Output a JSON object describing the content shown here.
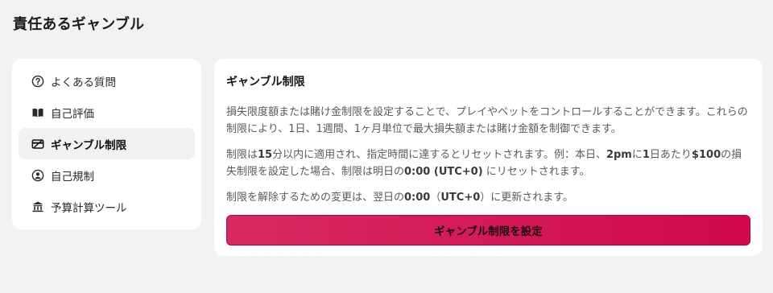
{
  "page": {
    "title": "責任あるギャンブル"
  },
  "sidebar": {
    "items": [
      {
        "label": "よくある質問",
        "icon": "question-circle-icon",
        "active": false
      },
      {
        "label": "自己評価",
        "icon": "book-icon",
        "active": false
      },
      {
        "label": "ギャンブル制限",
        "icon": "card-limit-icon",
        "active": true
      },
      {
        "label": "自己規制",
        "icon": "user-circle-icon",
        "active": false
      },
      {
        "label": "予算計算ツール",
        "icon": "bank-icon",
        "active": false
      }
    ]
  },
  "content": {
    "title": "ギャンブル制限",
    "para1": "損失限度額または賭け金制限を設定することで、プレイやベットをコントロールすることができます。これらの制限により、1日、1週間、1ヶ月単位で最大損失額または賭け金額を制御できます。",
    "para2_a": "制限は",
    "para2_b": "15",
    "para2_c": "分以内に適用され、指定時間に達するとリセットされます。例：本日、",
    "para2_d": "2pm",
    "para2_e": "に",
    "para2_f": "1",
    "para2_g": "日あたり",
    "para2_h": "$100",
    "para2_i": "の損失制限を設定した場合、制限は明日の",
    "para2_j": "0:00 (UTC+0)",
    "para2_k": " にリセットされます。",
    "para3_a": "制限を解除するための変更は、翌日の",
    "para3_b": "0:00",
    "para3_c": "（",
    "para3_d": "UTC+0",
    "para3_e": "）に更新されます。",
    "button_label": "ギャンブル制限を設定"
  },
  "colors": {
    "background": "#f2f2f3",
    "card": "#ffffff",
    "active_item": "#f1f1f2",
    "accent": "#d0084c"
  }
}
